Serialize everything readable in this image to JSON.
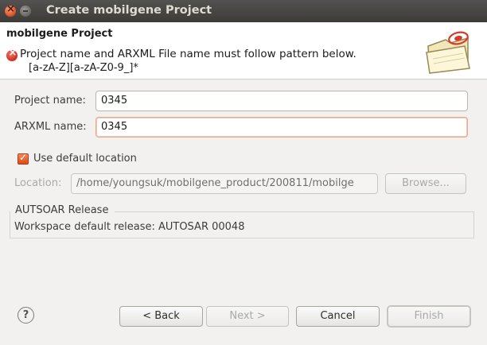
{
  "window": {
    "title": "Create mobilgene Project"
  },
  "header": {
    "title": "mobilgene Project",
    "error_message": "Project name and ARXML File name must follow pattern below.",
    "pattern": "[a-zA-Z][a-zA-Z0-9_]*"
  },
  "form": {
    "project_name_label": "Project name:",
    "project_name_value": "0345",
    "arxml_name_label": "ARXML name:",
    "arxml_name_value": "0345",
    "default_location_label": "Use default location",
    "default_location_checked": true,
    "location_label": "Location:",
    "location_value": "/home/youngsuk/mobilgene_product/200811/mobilge",
    "browse_label": "Browse..."
  },
  "release_group": {
    "title": "AUTSOAR Release",
    "text": "Workspace default release:  AUTOSAR 00048"
  },
  "buttons": {
    "help": "?",
    "back": "< Back",
    "next": "Next >",
    "cancel": "Cancel",
    "finish": "Finish"
  },
  "colors": {
    "accent": "#dd4814",
    "error": "#d02a22",
    "titlebar": "#3c3b37"
  }
}
